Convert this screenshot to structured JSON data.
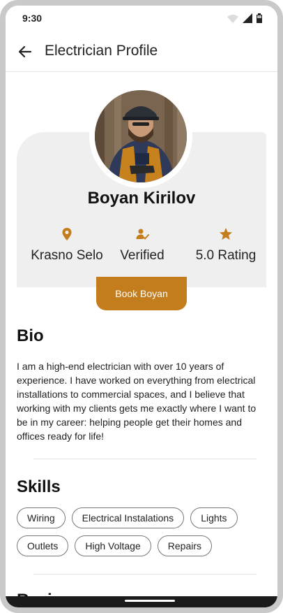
{
  "status": {
    "time": "9:30"
  },
  "header": {
    "title": "Electrician Profile"
  },
  "profile": {
    "name": "Boyan Kirilov",
    "stats": [
      {
        "icon": "location-pin-icon",
        "label": "Krasno Selo"
      },
      {
        "icon": "verified-user-icon",
        "label": "Verified"
      },
      {
        "icon": "star-icon",
        "label": "5.0 Rating"
      }
    ],
    "book_label": "Book Boyan"
  },
  "bio": {
    "title": "Bio",
    "text": "I am a high-end electrician with over 10 years of experience. I have worked on everything from electrical installations to commercial spaces, and I believe that working with my clients gets me exactly where I want to be in my career: helping people get their homes and offices ready for life!"
  },
  "skills": {
    "title": "Skills",
    "chips": [
      "Wiring",
      "Electrical Instalations",
      "Lights",
      "Outlets",
      "High Voltage",
      "Repairs"
    ]
  },
  "reviews": {
    "title": "Reviews"
  },
  "colors": {
    "accent": "#c37d1c",
    "card": "#efefef",
    "text": "#222222"
  }
}
